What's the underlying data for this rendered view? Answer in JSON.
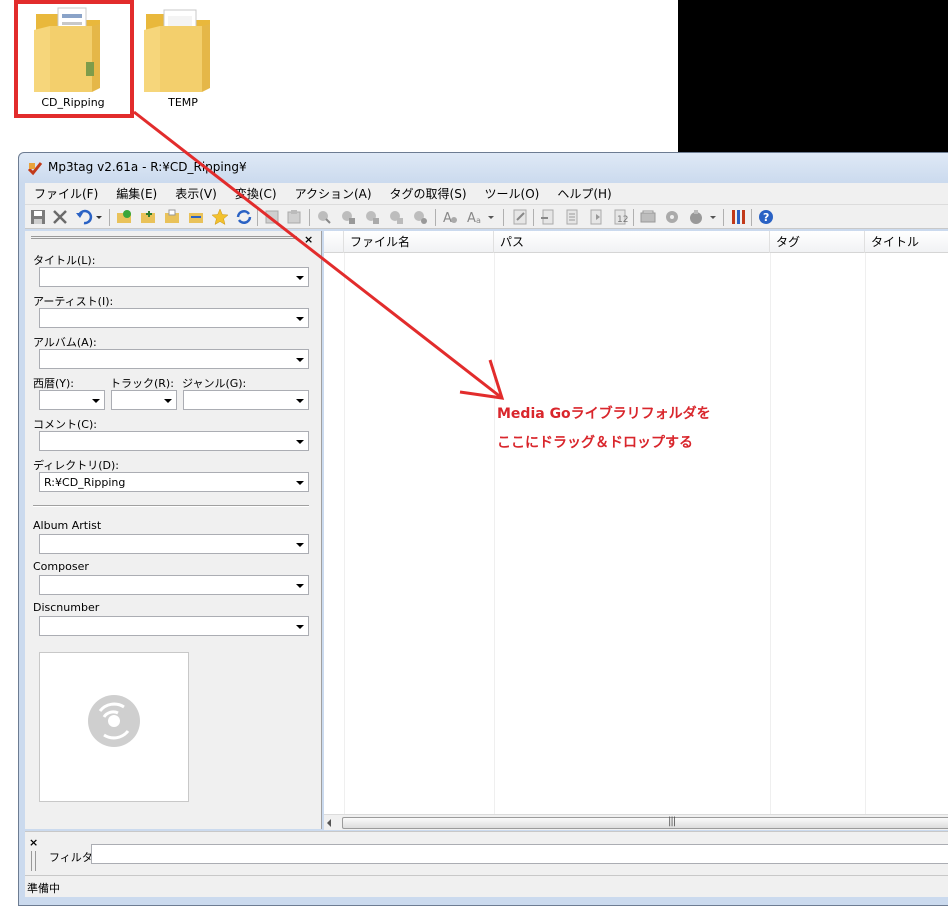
{
  "desktop": {
    "folders": [
      {
        "label": "CD_Ripping"
      },
      {
        "label": "TEMP"
      }
    ]
  },
  "window": {
    "title": "Mp3tag v2.61a  -  R:¥CD_Ripping¥"
  },
  "menu": [
    "ファイル(F)",
    "編集(E)",
    "表示(V)",
    "変換(C)",
    "アクション(A)",
    "タグの取得(S)",
    "ツール(O)",
    "ヘルプ(H)"
  ],
  "tag_panel": {
    "close": "×",
    "title_label": "タイトル(L):",
    "artist_label": "アーティスト(I):",
    "album_label": "アルバム(A):",
    "year_label": "西暦(Y):",
    "track_label": "トラック(R):",
    "genre_label": "ジャンル(G):",
    "comment_label": "コメント(C):",
    "directory_label": "ディレクトリ(D):",
    "directory_value": "R:¥CD_Ripping",
    "album_artist_label": "Album Artist",
    "composer_label": "Composer",
    "discnumber_label": "Discnumber"
  },
  "file_list": {
    "columns": [
      "ファイル名",
      "パス",
      "タグ",
      "タイトル"
    ]
  },
  "annotation": {
    "line1": "Media Goライブラリフォルダを",
    "line2": "ここにドラッグ＆ドロップする",
    "color": "#d9262c"
  },
  "filter": {
    "close": "×",
    "label": "フィルタ:",
    "value": ""
  },
  "status": {
    "text": "準備中"
  },
  "colors": {
    "highlight": "#e22c2c",
    "folder": "#f3d27a"
  }
}
